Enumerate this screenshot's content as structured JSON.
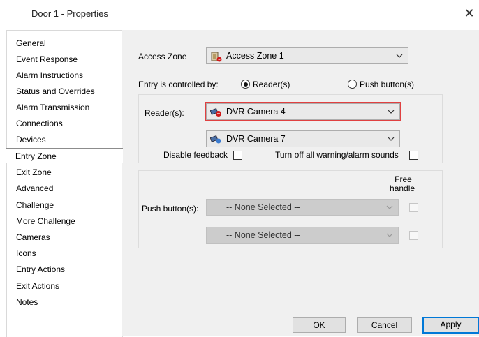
{
  "window": {
    "title": "Door 1 - Properties",
    "close_glyph": "✕"
  },
  "sidebar": {
    "items": [
      {
        "label": "General"
      },
      {
        "label": "Event Response"
      },
      {
        "label": "Alarm Instructions"
      },
      {
        "label": "Status and Overrides"
      },
      {
        "label": "Alarm Transmission"
      },
      {
        "label": "Connections"
      },
      {
        "label": "Devices"
      },
      {
        "label": "Entry Zone",
        "selected": true
      },
      {
        "label": "Exit Zone"
      },
      {
        "label": "Advanced"
      },
      {
        "label": "Challenge"
      },
      {
        "label": "More Challenge"
      },
      {
        "label": "Cameras"
      },
      {
        "label": "Icons"
      },
      {
        "label": "Entry Actions"
      },
      {
        "label": "Exit Actions"
      },
      {
        "label": "Notes"
      }
    ]
  },
  "main": {
    "access_zone": {
      "label": "Access Zone",
      "value": "Access Zone 1",
      "icon": "access-zone-icon"
    },
    "entry_control": {
      "label": "Entry is controlled by:",
      "options": [
        {
          "label": "Reader(s)",
          "checked": true
        },
        {
          "label": "Push button(s)",
          "checked": false
        }
      ]
    },
    "readers": {
      "label": "Reader(s):",
      "primary": {
        "value": "DVR Camera 4",
        "icon": "camera-alarm-icon",
        "highlighted": true
      },
      "secondary": {
        "value": "DVR Camera 7",
        "icon": "camera-icon"
      },
      "disable_feedback_label": "Disable feedback",
      "turn_off_sounds_label": "Turn off all warning/alarm sounds"
    },
    "push_buttons": {
      "label": "Push button(s):",
      "free_handle_label_line1": "Free",
      "free_handle_label_line2": "handle",
      "primary_value": "-- None Selected --",
      "secondary_value": "-- None Selected --"
    }
  },
  "buttons": {
    "ok": "OK",
    "cancel": "Cancel",
    "apply": "Apply"
  },
  "colors": {
    "highlight": "#e04040",
    "focus_blue": "#0078d7",
    "panel_bg": "#f0f0f0"
  }
}
